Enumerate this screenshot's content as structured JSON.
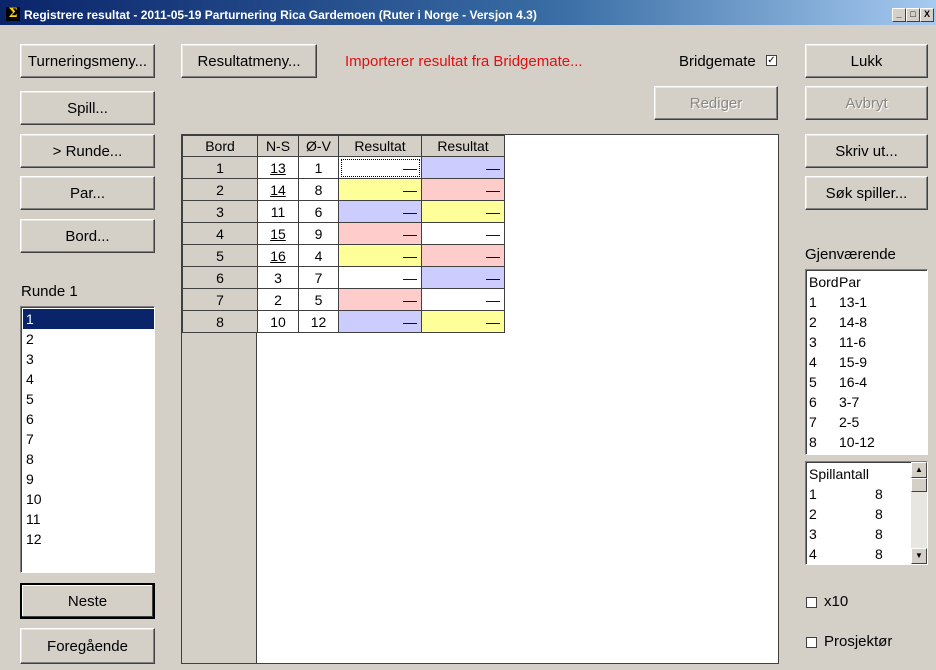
{
  "window": {
    "title": "Registrere resultat - 2011-05-19  Parturnering Rica Gardemoen  (Ruter i Norge - Versjon 4.3)",
    "icon": "sigma-icon",
    "min": "_",
    "max": "□",
    "close": "X"
  },
  "left": {
    "turneringsmeny": "Turneringsmeny...",
    "spill": "Spill...",
    "runde": ">  Runde...",
    "par": "Par...",
    "bord": "Bord...",
    "runde_label": "Runde 1",
    "rounds": [
      "1",
      "2",
      "3",
      "4",
      "5",
      "6",
      "7",
      "8",
      "9",
      "10",
      "11",
      "12"
    ],
    "selected_round": "1",
    "neste": "Neste",
    "foregaende": "Foregående"
  },
  "center": {
    "resultatmeny": "Resultatmeny...",
    "status": "Importerer resultat fra Bridgemate...",
    "bridgemate_label": "Bridgemate",
    "bridgemate_checked": "✓",
    "rediger": "Rediger",
    "columns": [
      "Bord",
      "N-S",
      "Ø-V",
      "Resultat",
      "Resultat"
    ],
    "rows": [
      {
        "bord": "1",
        "ns": "13",
        "ov": "1",
        "r1": "—",
        "r2": "—"
      },
      {
        "bord": "2",
        "ns": "14",
        "ov": "8",
        "r1": "—",
        "r2": "—"
      },
      {
        "bord": "3",
        "ns": "11",
        "ov": "6",
        "r1": "—",
        "r2": "—"
      },
      {
        "bord": "4",
        "ns": "15",
        "ov": "9",
        "r1": "—",
        "r2": "—"
      },
      {
        "bord": "5",
        "ns": "16",
        "ov": "4",
        "r1": "—",
        "r2": "—"
      },
      {
        "bord": "6",
        "ns": "3",
        "ov": "7",
        "r1": "—",
        "r2": "—"
      },
      {
        "bord": "7",
        "ns": "2",
        "ov": "5",
        "r1": "—",
        "r2": "—"
      },
      {
        "bord": "8",
        "ns": "10",
        "ov": "12",
        "r1": "—",
        "r2": "—"
      }
    ]
  },
  "right": {
    "lukk": "Lukk",
    "avbryt": "Avbryt",
    "skriv_ut": "Skriv ut...",
    "sok_spiller": "Søk spiller...",
    "gjenvaerende": "Gjenværende",
    "remaining_header": {
      "bord": "Bord",
      "par": "Par"
    },
    "remaining": [
      {
        "bord": "1",
        "par": "13-1"
      },
      {
        "bord": "2",
        "par": "14-8"
      },
      {
        "bord": "3",
        "par": "11-6"
      },
      {
        "bord": "4",
        "par": "15-9"
      },
      {
        "bord": "5",
        "par": "16-4"
      },
      {
        "bord": "6",
        "par": "3-7"
      },
      {
        "bord": "7",
        "par": "2-5"
      },
      {
        "bord": "8",
        "par": "10-12"
      }
    ],
    "spillantall_header": "Spillantall",
    "spillantall": [
      {
        "n": "1",
        "v": "8"
      },
      {
        "n": "2",
        "v": "8"
      },
      {
        "n": "3",
        "v": "8"
      },
      {
        "n": "4",
        "v": "8"
      }
    ],
    "x10_label": "x10",
    "prosjektor_label": "Prosjektør"
  },
  "colors": {
    "yellow": "#ffff99",
    "pink": "#ffcccc",
    "blue": "#ccccff",
    "status_red": "#e01010",
    "selection": "#0a246a"
  }
}
